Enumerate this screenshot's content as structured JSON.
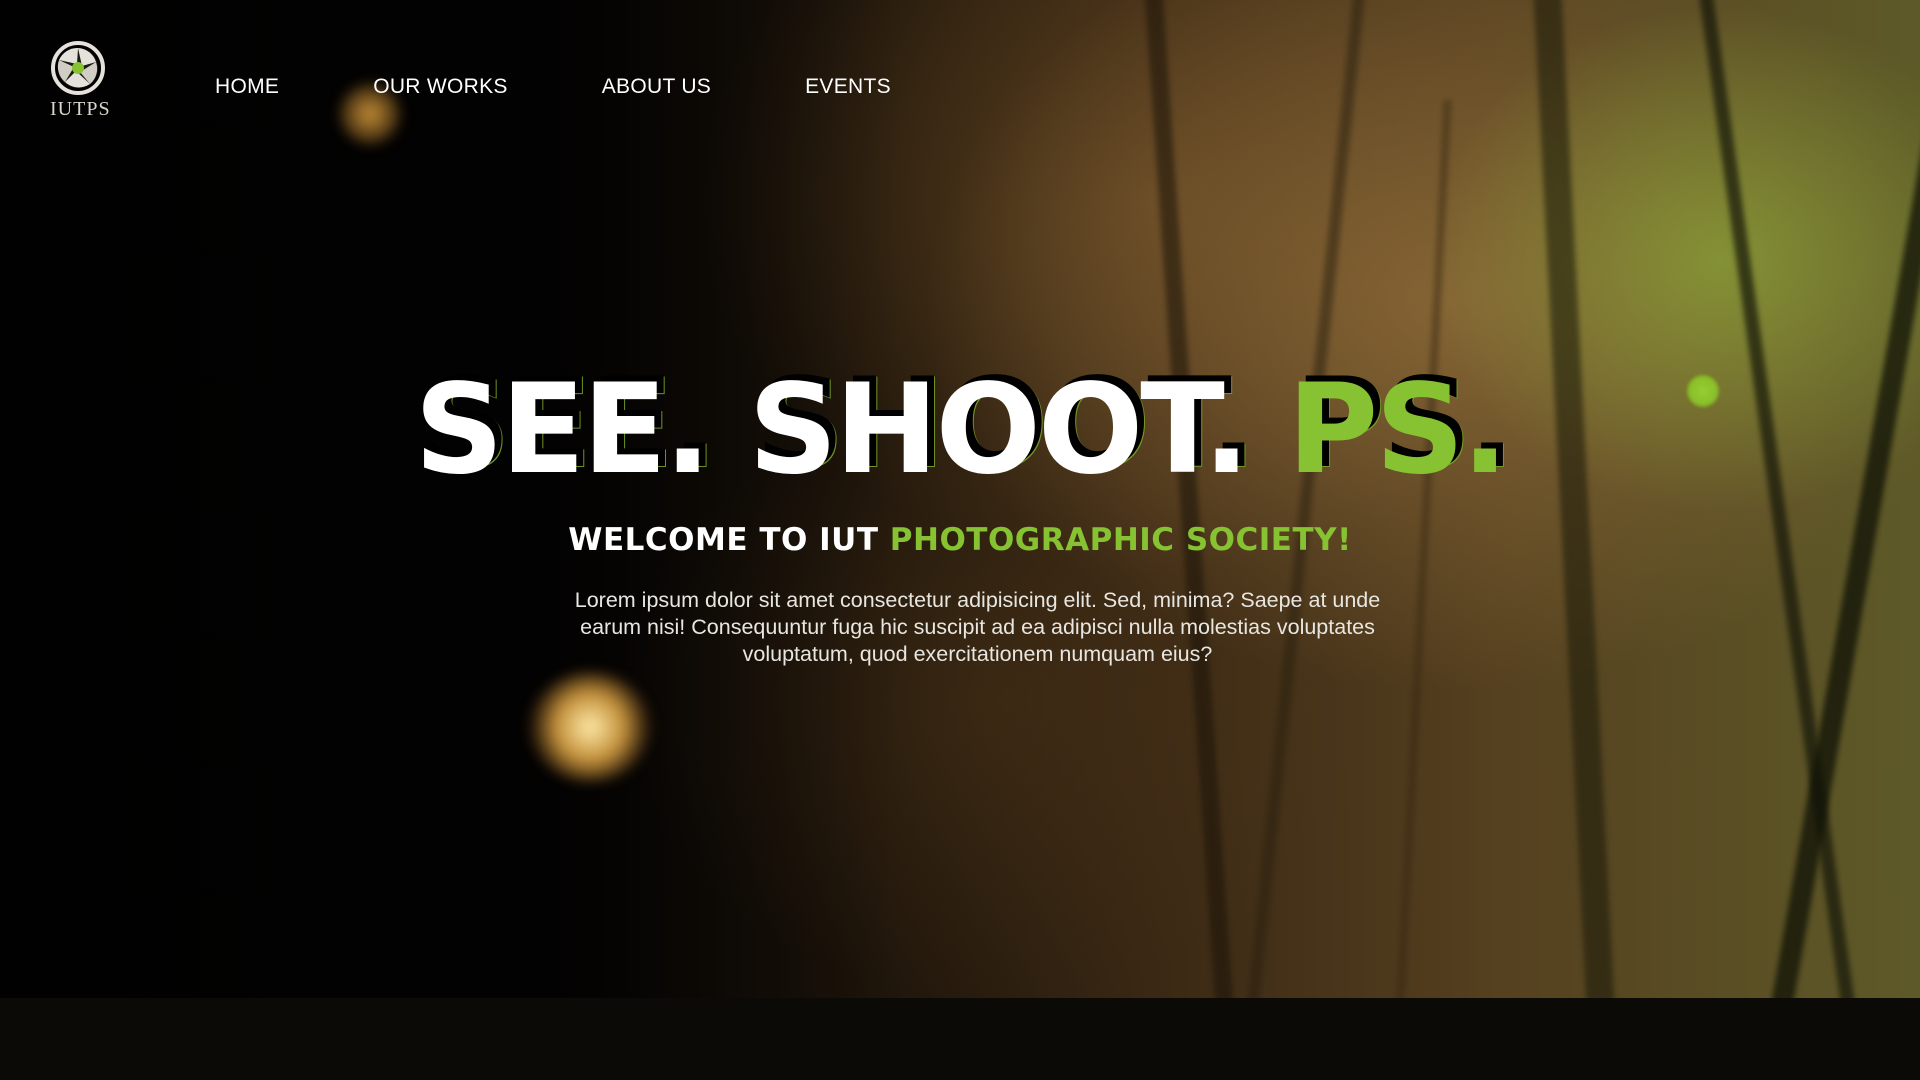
{
  "brand": {
    "logo_text": "IUTPS",
    "logo_icon": "camera-aperture-icon"
  },
  "nav": {
    "items": [
      {
        "label": "HOME"
      },
      {
        "label": "OUR WORKS"
      },
      {
        "label": "ABOUT US"
      },
      {
        "label": "EVENTS"
      }
    ]
  },
  "hero": {
    "headline_part1": "SEE. SHOOT.",
    "headline_part2": "PS.",
    "welcome_part1": "WELCOME TO IUT",
    "welcome_part2": "PHOTOGRAPHIC SOCIETY!",
    "description": "Lorem ipsum dolor sit amet consectetur adipisicing elit. Sed, minima? Saepe at unde earum nisi! Consequuntur fuga hic suscipit ad ea adipisci nulla molestias voluptates voluptatum, quod exercitationem numquam eius?"
  },
  "colors": {
    "accent": "#86c232",
    "text": "#ffffff",
    "background": "#0c0a06"
  }
}
